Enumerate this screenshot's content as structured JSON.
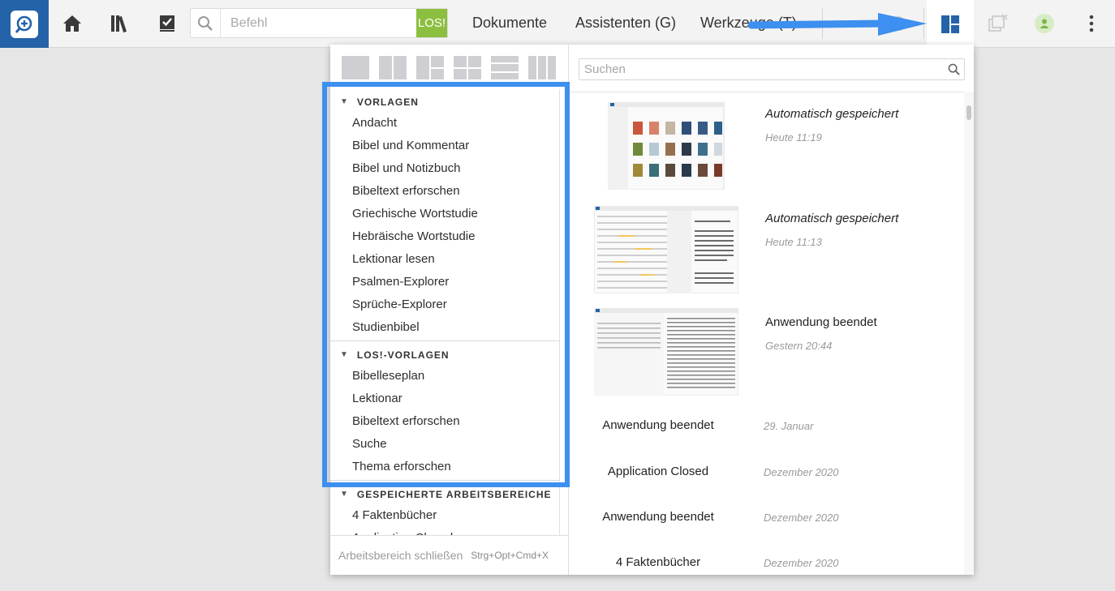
{
  "toolbar": {
    "command_placeholder": "Befehl",
    "go_label": "LOS!",
    "menu_documents": "Dokumente",
    "menu_guides": "Assistenten (G)",
    "menu_tools": "Werkzeuge (T)",
    "accent": "#2463a8",
    "go_color": "#8cbf3f",
    "icons": [
      "logo-icon",
      "home-icon",
      "library-icon",
      "checklist-icon",
      "search-icon",
      "layout-icon",
      "close-all-icon",
      "user-icon",
      "more-icon"
    ]
  },
  "panel": {
    "search_placeholder": "Suchen",
    "sections": [
      {
        "title": "VORLAGEN",
        "items": [
          "Andacht",
          "Bibel und Kommentar",
          "Bibel und Notizbuch",
          "Bibeltext erforschen",
          "Griechische Wortstudie",
          "Hebräische Wortstudie",
          "Lektionar lesen",
          "Psalmen-Explorer",
          "Sprüche-Explorer",
          "Studienbibel"
        ]
      },
      {
        "title": "LOS!-VORLAGEN",
        "items": [
          "Bibelleseplan",
          "Lektionar",
          "Bibeltext erforschen",
          "Suche",
          "Thema erforschen"
        ]
      },
      {
        "title": "GESPEICHERTE ARBEITSBEREICHE",
        "items": [
          "4 Faktenbücher",
          "Application Closed"
        ]
      }
    ],
    "close_workspace": "Arbeitsbereich schließen",
    "close_shortcut": "Strg+Opt+Cmd+X"
  },
  "history": [
    {
      "name": "Automatisch gespeichert",
      "time": "Heute 11:19"
    },
    {
      "name": "Automatisch gespeichert",
      "time": "Heute 11:13"
    },
    {
      "name": "Anwendung beendet",
      "time": "Gestern 20:44"
    },
    {
      "name": "Anwendung beendet",
      "time": "29. Januar"
    },
    {
      "name": "Application Closed",
      "time": "Dezember 2020"
    },
    {
      "name": "Anwendung beendet",
      "time": "Dezember 2020"
    },
    {
      "name": "4 Faktenbücher",
      "time": "Dezember 2020"
    }
  ],
  "annotation_color": "#3d8ff0"
}
